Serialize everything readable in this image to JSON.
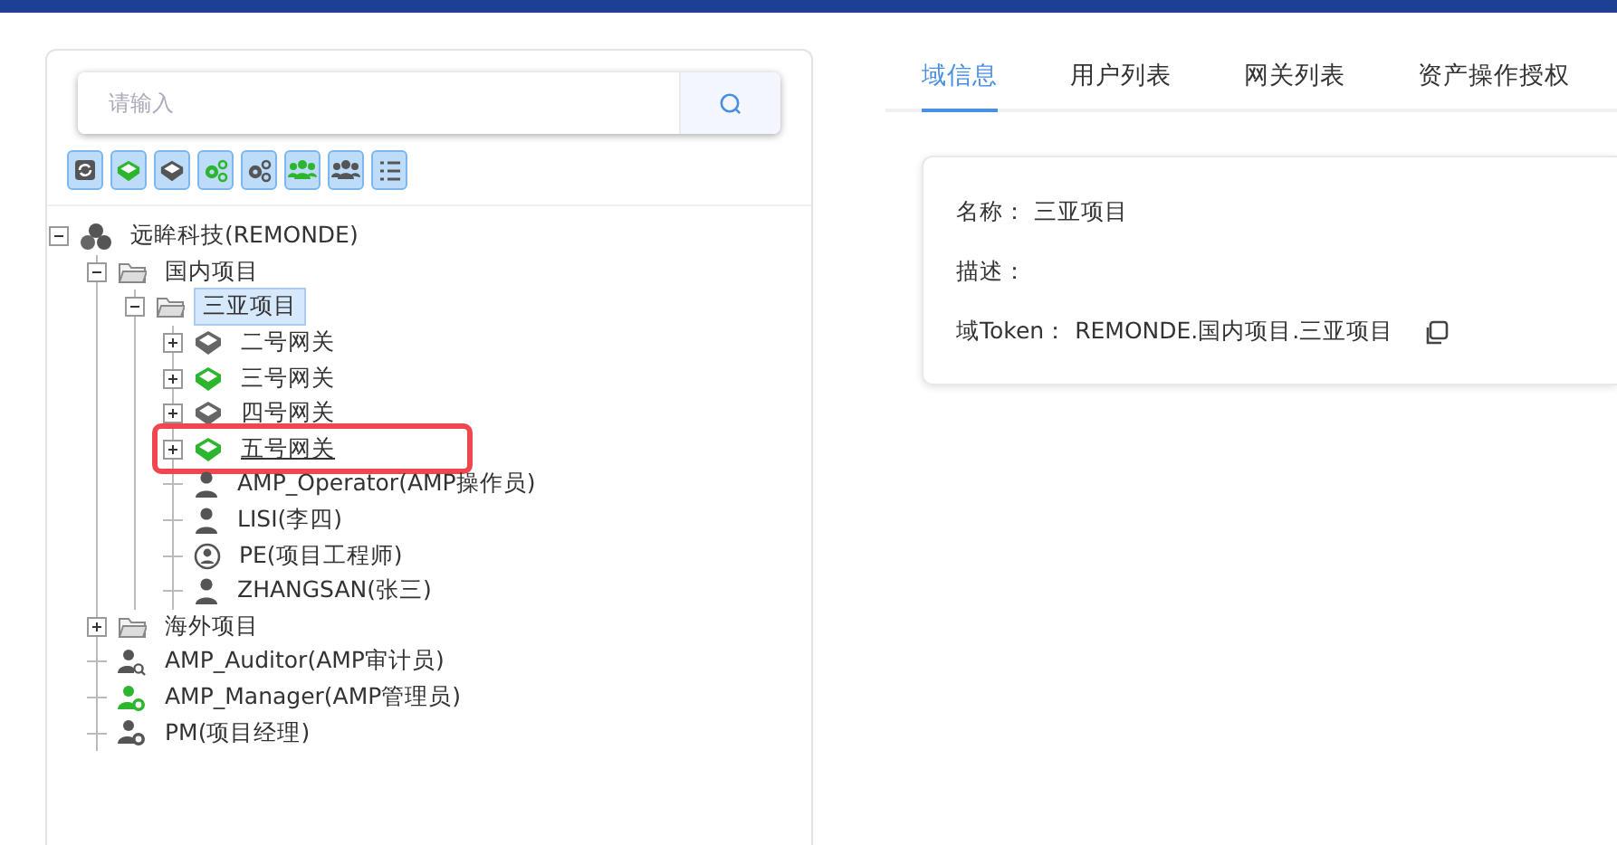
{
  "search": {
    "placeholder": "请输入"
  },
  "toolbar": [
    {
      "kind": "refresh"
    },
    {
      "kind": "gateway",
      "on": true
    },
    {
      "kind": "gateway",
      "on": false
    },
    {
      "kind": "gears",
      "on": true
    },
    {
      "kind": "gears",
      "on": false
    },
    {
      "kind": "group",
      "on": true
    },
    {
      "kind": "group",
      "on": false
    },
    {
      "kind": "list"
    }
  ],
  "tree": [
    {
      "label": "远眸科技(REMONDE)",
      "kind": "org",
      "expanded": true,
      "selected": false,
      "highlighted": false,
      "children": [
        {
          "label": "国内项目",
          "kind": "folder",
          "expanded": true,
          "selected": false,
          "highlighted": false,
          "children": [
            {
              "label": "三亚项目",
              "kind": "folder",
              "expanded": true,
              "selected": true,
              "highlighted": false,
              "children": [
                {
                  "label": "二号网关",
                  "kind": "gateway",
                  "online": false,
                  "expanded": false,
                  "selected": false,
                  "highlighted": false
                },
                {
                  "label": "三号网关",
                  "kind": "gateway",
                  "online": true,
                  "expanded": false,
                  "selected": false,
                  "highlighted": false
                },
                {
                  "label": "四号网关",
                  "kind": "gateway",
                  "online": false,
                  "expanded": false,
                  "selected": false,
                  "highlighted": false
                },
                {
                  "label": "五号网关",
                  "kind": "gateway",
                  "online": true,
                  "expanded": false,
                  "selected": false,
                  "highlighted": true
                },
                {
                  "label": "AMP_Operator(AMP操作员)",
                  "kind": "user",
                  "selected": false,
                  "highlighted": false
                },
                {
                  "label": "LISI(李四)",
                  "kind": "user",
                  "selected": false,
                  "highlighted": false
                },
                {
                  "label": "PE(项目工程师)",
                  "kind": "user-circle",
                  "selected": false,
                  "highlighted": false
                },
                {
                  "label": "ZHANGSAN(张三)",
                  "kind": "user",
                  "selected": false,
                  "highlighted": false
                }
              ]
            }
          ]
        },
        {
          "label": "海外项目",
          "kind": "folder",
          "expanded": false,
          "selected": false,
          "highlighted": false
        },
        {
          "label": "AMP_Auditor(AMP审计员)",
          "kind": "auditor",
          "selected": false,
          "highlighted": false
        },
        {
          "label": "AMP_Manager(AMP管理员)",
          "kind": "manager",
          "selected": false,
          "highlighted": false
        },
        {
          "label": "PM(项目经理)",
          "kind": "pm",
          "selected": false,
          "highlighted": false
        }
      ]
    }
  ],
  "tabs": [
    {
      "label": "域信息",
      "selected": true
    },
    {
      "label": "用户列表",
      "selected": false
    },
    {
      "label": "网关列表",
      "selected": false
    },
    {
      "label": "资产操作授权",
      "selected": false
    }
  ],
  "info": {
    "rows": [
      {
        "label": "名称：",
        "value": "三亚项目"
      },
      {
        "label": "描述："
      },
      {
        "label": "域Token：",
        "value": "REMONDE.国内项目.三亚项目",
        "copyable": true
      }
    ]
  }
}
